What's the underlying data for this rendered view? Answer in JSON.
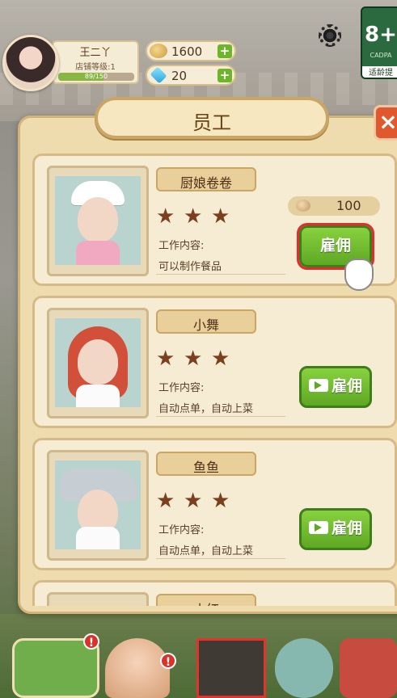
{
  "hud": {
    "player_name": "王二丫",
    "shop_level_label": "店铺等级:1",
    "xp_text": "89/150",
    "xp_progress": 0.593,
    "coins": "1600",
    "gems": "20",
    "plus_symbol": "+",
    "age_rating": "8+",
    "age_org": "CADPA",
    "age_tip": "适龄提"
  },
  "dialog": {
    "title": "员工",
    "close_symbol": "×"
  },
  "staff": [
    {
      "name": "厨娘卷卷",
      "stars": 3,
      "star_glyphs": [
        "★",
        "★",
        "★"
      ],
      "job_label": "工作内容:",
      "job_text": "可以制作餐品",
      "cost": "100",
      "hire_label": "雇佣",
      "hire_type": "coin"
    },
    {
      "name": "小舞",
      "stars": 3,
      "star_glyphs": [
        "★",
        "★",
        "★"
      ],
      "job_label": "工作内容:",
      "job_text": "自动点单，自动上菜",
      "hire_label": "雇佣",
      "hire_type": "video"
    },
    {
      "name": "鱼鱼",
      "stars": 3,
      "star_glyphs": [
        "★",
        "★",
        "★"
      ],
      "job_label": "工作内容:",
      "job_text": "自动点单，自动上菜",
      "hire_label": "雇佣",
      "hire_type": "video"
    },
    {
      "name": "小红"
    }
  ],
  "bottom_bar": {
    "alert_symbol": "!"
  },
  "colors": {
    "accent_green": "#6fb52c",
    "close_red": "#e1582e",
    "panel_bg": "#efdcae",
    "star_brown": "#7a3f1e"
  },
  "icons": {
    "coin": "coin-icon",
    "gem": "gem-icon",
    "settings": "gear-icon",
    "video": "video-icon",
    "close": "close-icon",
    "star": "star-icon",
    "pointer": "hand-pointer-icon"
  }
}
